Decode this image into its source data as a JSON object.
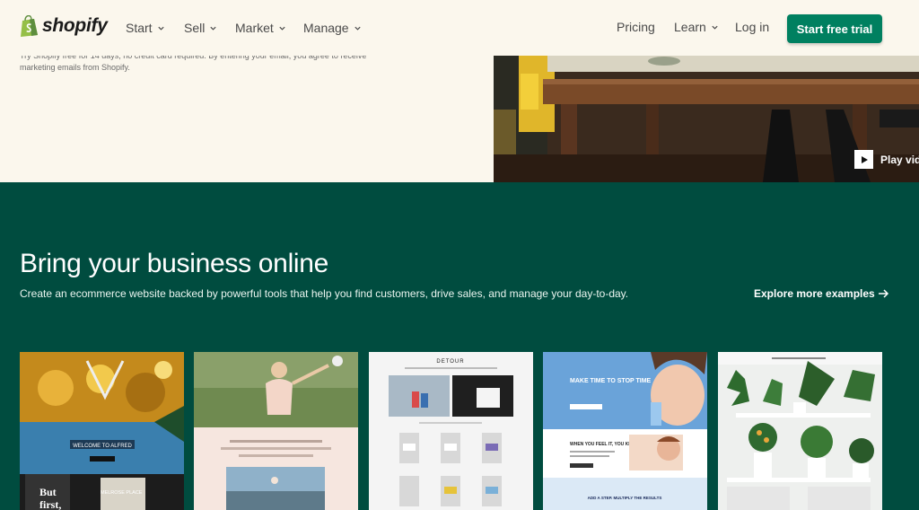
{
  "brand": {
    "name": "shopify",
    "accent": "#008060",
    "section_bg": "#004c3f",
    "hero_bg": "#fbf7ed"
  },
  "nav": {
    "left": [
      {
        "label": "Start"
      },
      {
        "label": "Sell"
      },
      {
        "label": "Market"
      },
      {
        "label": "Manage"
      }
    ],
    "pricing": "Pricing",
    "learn": "Learn",
    "login": "Log in",
    "cta": "Start free trial"
  },
  "hero": {
    "note": "Try Shopify free for 14 days, no credit card required. By entering your email, you agree to receive marketing emails from Shopify.",
    "play_label": "Play vid"
  },
  "section": {
    "title": "Bring your business online",
    "description": "Create an ecommerce website backed by powerful tools that help you find customers, drive sales, and manage your day-to-day.",
    "explore": "Explore more examples"
  },
  "cards": {
    "c1": {
      "banner": "WELCOME TO ALFRED",
      "sign": "MELROSE PLACE",
      "big": "But first,"
    },
    "c3": {
      "logo": "DETOUR"
    },
    "c4": {
      "headline": "MAKE TIME TO STOP TIME",
      "sub": "WHEN YOU FEEL IT, YOU KNOW",
      "footer": "ADD A STEP. MULTIPLY THE RESULTS"
    }
  }
}
